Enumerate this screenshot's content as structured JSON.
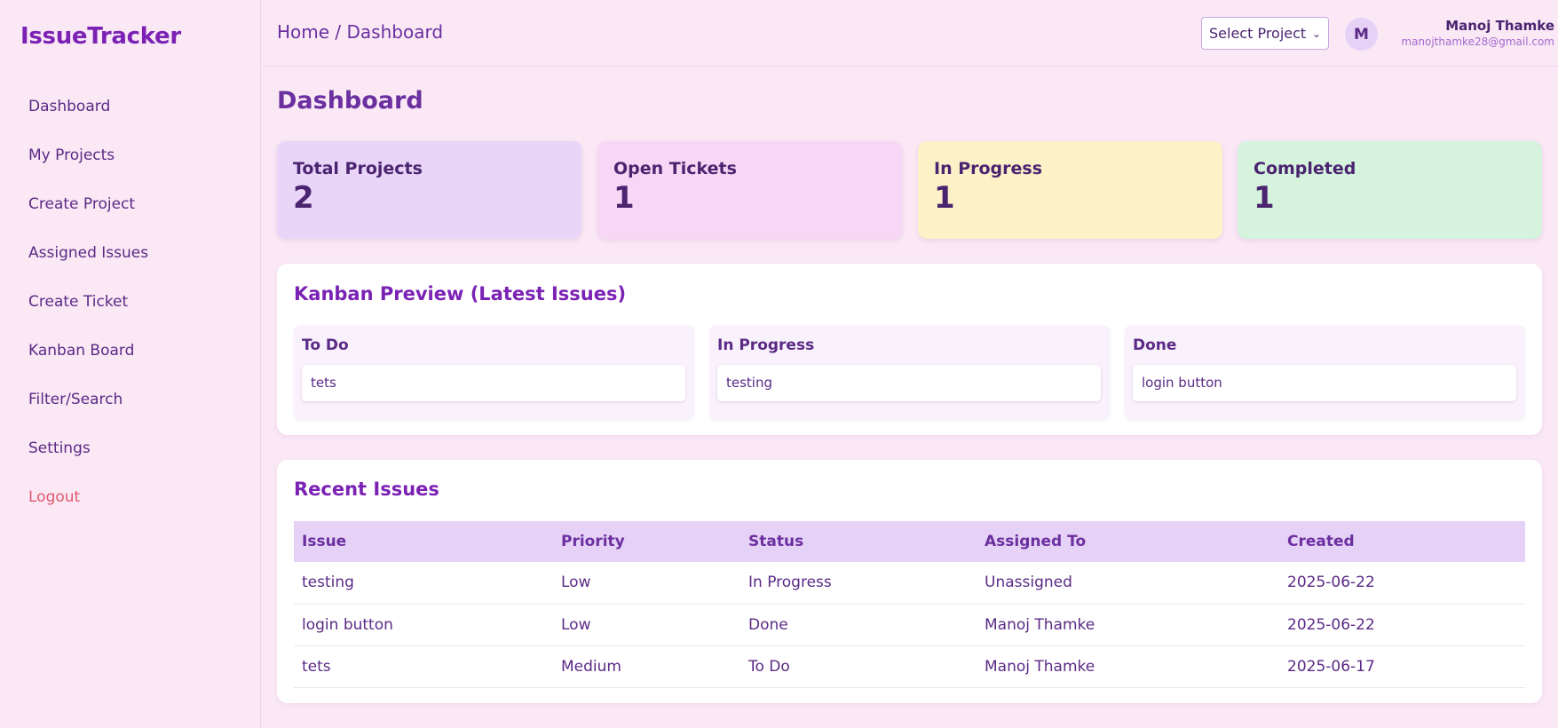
{
  "app": {
    "brand": "IssueTracker"
  },
  "sidebar": {
    "items": [
      {
        "label": "Dashboard"
      },
      {
        "label": "My Projects"
      },
      {
        "label": "Create Project"
      },
      {
        "label": "Assigned Issues"
      },
      {
        "label": "Create Ticket"
      },
      {
        "label": "Kanban Board"
      },
      {
        "label": "Filter/Search"
      },
      {
        "label": "Settings"
      },
      {
        "label": "Logout"
      }
    ]
  },
  "header": {
    "breadcrumb": "Home / Dashboard",
    "project_select": "Select Project",
    "avatar_initial": "M",
    "user_name": "Manoj Thamke",
    "user_email": "manojthamke28@gmail.com"
  },
  "main": {
    "title": "Dashboard",
    "stats": [
      {
        "label": "Total Projects",
        "value": "2",
        "color": "#e8d5f8"
      },
      {
        "label": "Open Tickets",
        "value": "1",
        "color": "#f8d6f5"
      },
      {
        "label": "In Progress",
        "value": "1",
        "color": "#fdf1c8"
      },
      {
        "label": "Completed",
        "value": "1",
        "color": "#d5f3dd"
      }
    ],
    "kanban": {
      "title": "Kanban Preview (Latest Issues)",
      "columns": [
        {
          "title": "To Do",
          "card": "tets"
        },
        {
          "title": "In Progress",
          "card": "testing"
        },
        {
          "title": "Done",
          "card": "login button"
        }
      ]
    },
    "recent": {
      "title": "Recent Issues",
      "headers": [
        "Issue",
        "Priority",
        "Status",
        "Assigned To",
        "Created"
      ],
      "rows": [
        [
          "testing",
          "Low",
          "In Progress",
          "Unassigned",
          "2025-06-22"
        ],
        [
          "login button",
          "Low",
          "Done",
          "Manoj Thamke",
          "2025-06-22"
        ],
        [
          "tets",
          "Medium",
          "To Do",
          "Manoj Thamke",
          "2025-06-17"
        ]
      ]
    }
  },
  "colors": {
    "accent": "#7b22b5",
    "background": "#fae8f5",
    "logout": "#e05a6e"
  }
}
